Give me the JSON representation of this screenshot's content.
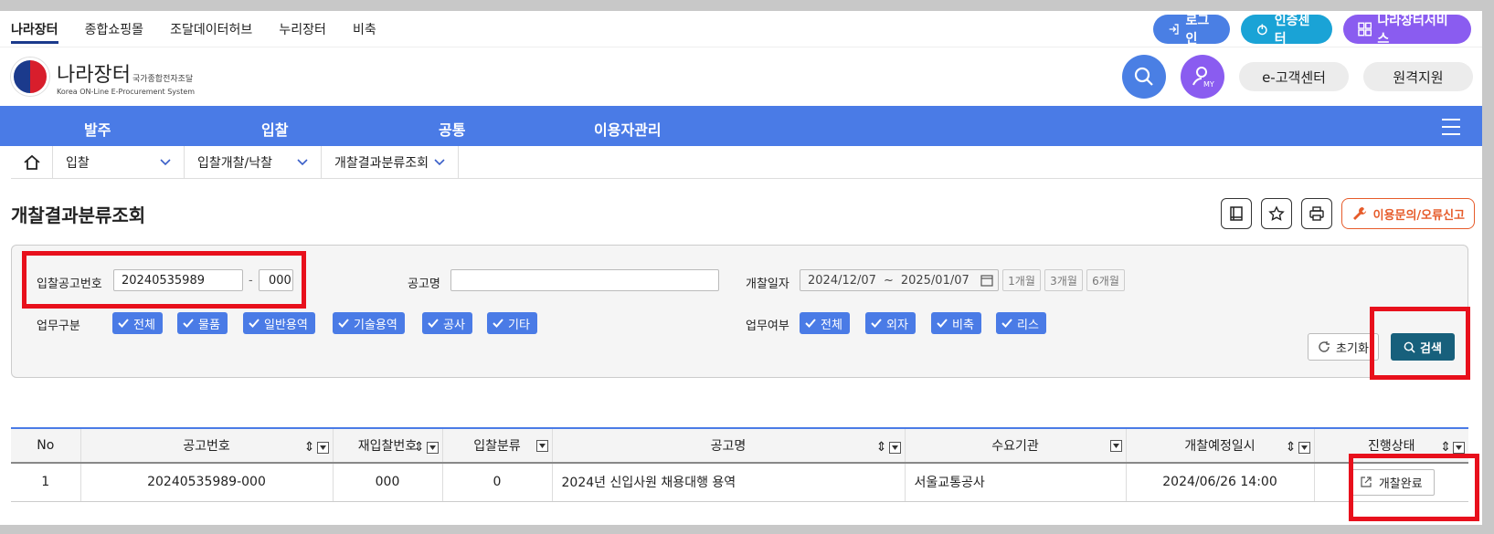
{
  "topnav": [
    "나라장터",
    "종합쇼핑몰",
    "조달데이터허브",
    "누리장터",
    "비축"
  ],
  "topbuttons": {
    "login": "로그인",
    "auth": "인증센터",
    "service": "나라장터서비스"
  },
  "logo": {
    "name": "나라장터",
    "sub": "국가종합전자조달",
    "eng": "Korea ON-Line E-Procurement System"
  },
  "header": {
    "my": "MY",
    "customer": "e-고객센터",
    "remote": "원격지원"
  },
  "mainnav": [
    "발주",
    "입찰",
    "공통",
    "이용자관리"
  ],
  "breadcrumb": [
    "입찰",
    "입찰개찰/낙찰",
    "개찰결과분류조회"
  ],
  "page_title": "개찰결과분류조회",
  "report_label": "이용문의/오류신고",
  "search": {
    "bid_no_label": "입찰공고번호",
    "bid_no_value": "20240535989",
    "bid_no_dash": "-",
    "bid_seq_value": "000",
    "notice_name_label": "공고명",
    "notice_name_value": "",
    "open_date_label": "개찰일자",
    "date_from": "2024/12/07",
    "date_tilde": "~",
    "date_to": "2025/01/07",
    "periods": [
      "1개월",
      "3개월",
      "6개월"
    ],
    "work_type_label": "업무구분",
    "work_types": [
      "전체",
      "물품",
      "일반용역",
      "기술용역",
      "공사",
      "기타"
    ],
    "work_yn_label": "업무여부",
    "work_yn": [
      "전체",
      "외자",
      "비축",
      "리스"
    ],
    "reset_label": "초기화",
    "search_label": "검색"
  },
  "table": {
    "headers": [
      "No",
      "공고번호",
      "재입찰번호",
      "입찰분류",
      "공고명",
      "수요기관",
      "개찰예정일시",
      "진행상태"
    ],
    "rows": [
      {
        "no": "1",
        "notice_no": "20240535989-000",
        "rebid_no": "000",
        "bid_class": "0",
        "notice_name": "2024년 신입사원 채용대행 용역",
        "agency": "서울교통공사",
        "open_datetime": "2024/06/26 14:00",
        "status": "개찰완료"
      }
    ]
  },
  "colors": {
    "primary": "#4a7be6",
    "search_button": "#17607c",
    "highlight": "#e8101c"
  }
}
